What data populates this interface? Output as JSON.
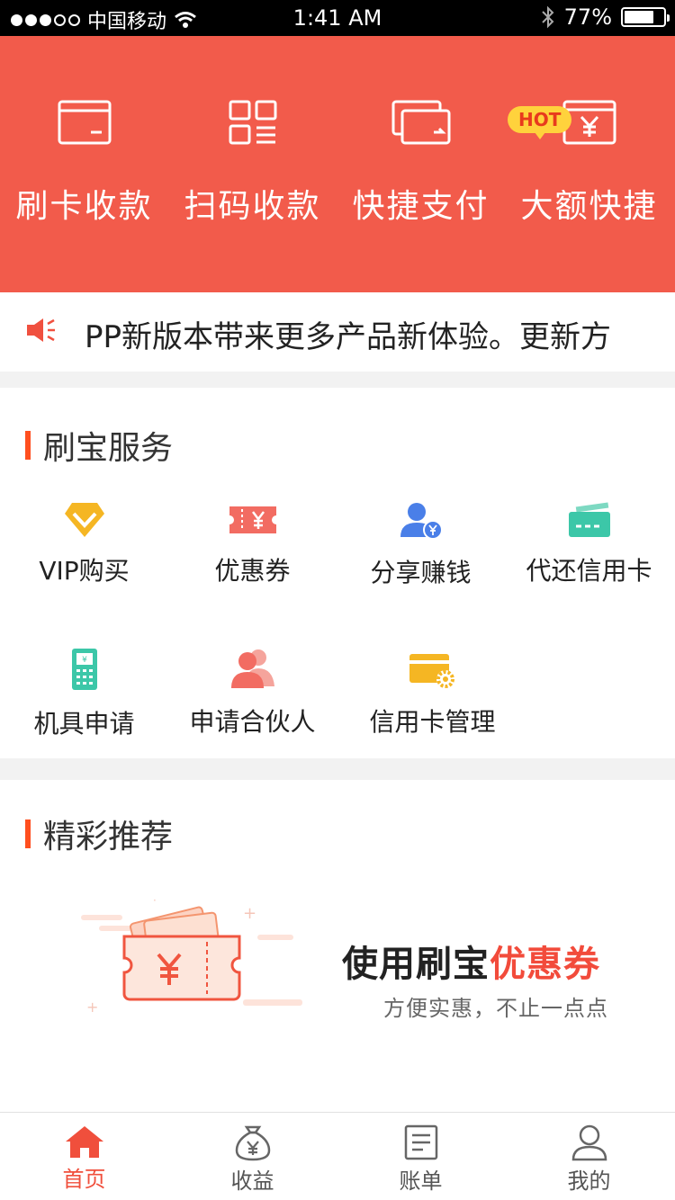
{
  "status_bar": {
    "carrier": "中国移动",
    "time": "1:41 AM",
    "battery": "77%",
    "battery_level": 0.77,
    "signal_bars": 3,
    "icons": [
      "signal-dots-icon",
      "wifi-icon",
      "bluetooth-icon",
      "battery-icon"
    ]
  },
  "hero": {
    "background": "#f25b4b",
    "badge": "HOT",
    "items": [
      {
        "label": "刷卡收款",
        "icon": "card-swipe-icon"
      },
      {
        "label": "扫码收款",
        "icon": "qr-scan-icon"
      },
      {
        "label": "快捷支付",
        "icon": "quick-pay-icon"
      },
      {
        "label": "大额快捷",
        "icon": "yuan-card-icon"
      }
    ]
  },
  "notice": {
    "icon": "speaker-icon",
    "text": "PP新版本带来更多产品新体验。更新方"
  },
  "services": {
    "title": "刷宝服务",
    "items": [
      {
        "label": "VIP购买",
        "icon": "vip-diamond-icon",
        "color": "#f5b623"
      },
      {
        "label": "优惠券",
        "icon": "coupon-icon",
        "color": "#f26c62"
      },
      {
        "label": "分享赚钱",
        "icon": "share-user-icon",
        "color": "#4a7fe8"
      },
      {
        "label": "代还信用卡",
        "icon": "credit-card-icon",
        "color": "#3cc7a8"
      },
      {
        "label": "机具申请",
        "icon": "pos-terminal-icon",
        "color": "#3cc7a8"
      },
      {
        "label": "申请合伙人",
        "icon": "partners-icon",
        "color": "#f26c62"
      },
      {
        "label": "信用卡管理",
        "icon": "card-settings-icon",
        "color": "#f5b623"
      }
    ]
  },
  "recommend": {
    "title": "精彩推荐",
    "promo_title_prefix": "使用刷宝",
    "promo_title_highlight": "优惠券",
    "promo_subtitle": "方便实惠，不止一点点"
  },
  "tabbar": {
    "active_color": "#f04f3c",
    "tabs": [
      {
        "label": "首页",
        "icon": "home-icon",
        "active": true
      },
      {
        "label": "收益",
        "icon": "money-bag-icon",
        "active": false
      },
      {
        "label": "账单",
        "icon": "bill-icon",
        "active": false
      },
      {
        "label": "我的",
        "icon": "profile-icon",
        "active": false
      }
    ]
  }
}
